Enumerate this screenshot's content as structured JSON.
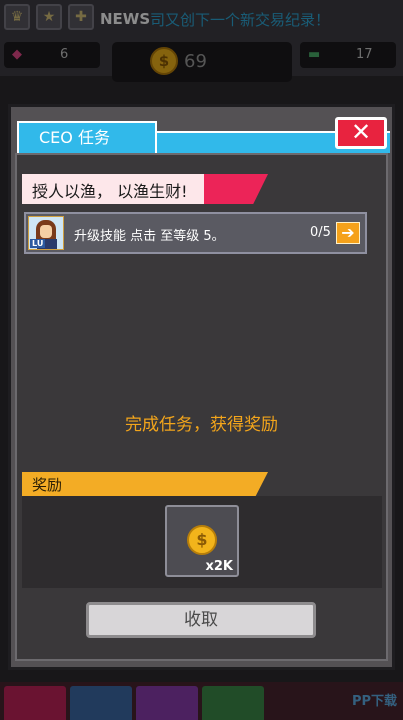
{
  "top_bar": {
    "news_tag": "NEWS",
    "news_text": "司又创下一个新交易纪录！"
  },
  "resources": {
    "gems": "6",
    "coins": "69",
    "cash": "17"
  },
  "dialog": {
    "title": "CEO 任务",
    "close_icon": "close-icon",
    "quest_title": "授人以渔， 以渔生财!",
    "task": {
      "avatar_badge": "LU",
      "description": "升级技能 点击 至等级 5。",
      "progress": "0/5"
    },
    "prompt": "完成任务，获得奖励",
    "reward_header": "奖励",
    "reward_count": "x2K",
    "collect_label": "收取"
  },
  "watermark": "PP下载",
  "colors": {
    "title_bar": "#31b9ea",
    "close_button": "#e8233f",
    "quest_ribbon": "#ec2458",
    "reward_ribbon": "#f3ac25",
    "prompt_text": "#f3a51b"
  }
}
